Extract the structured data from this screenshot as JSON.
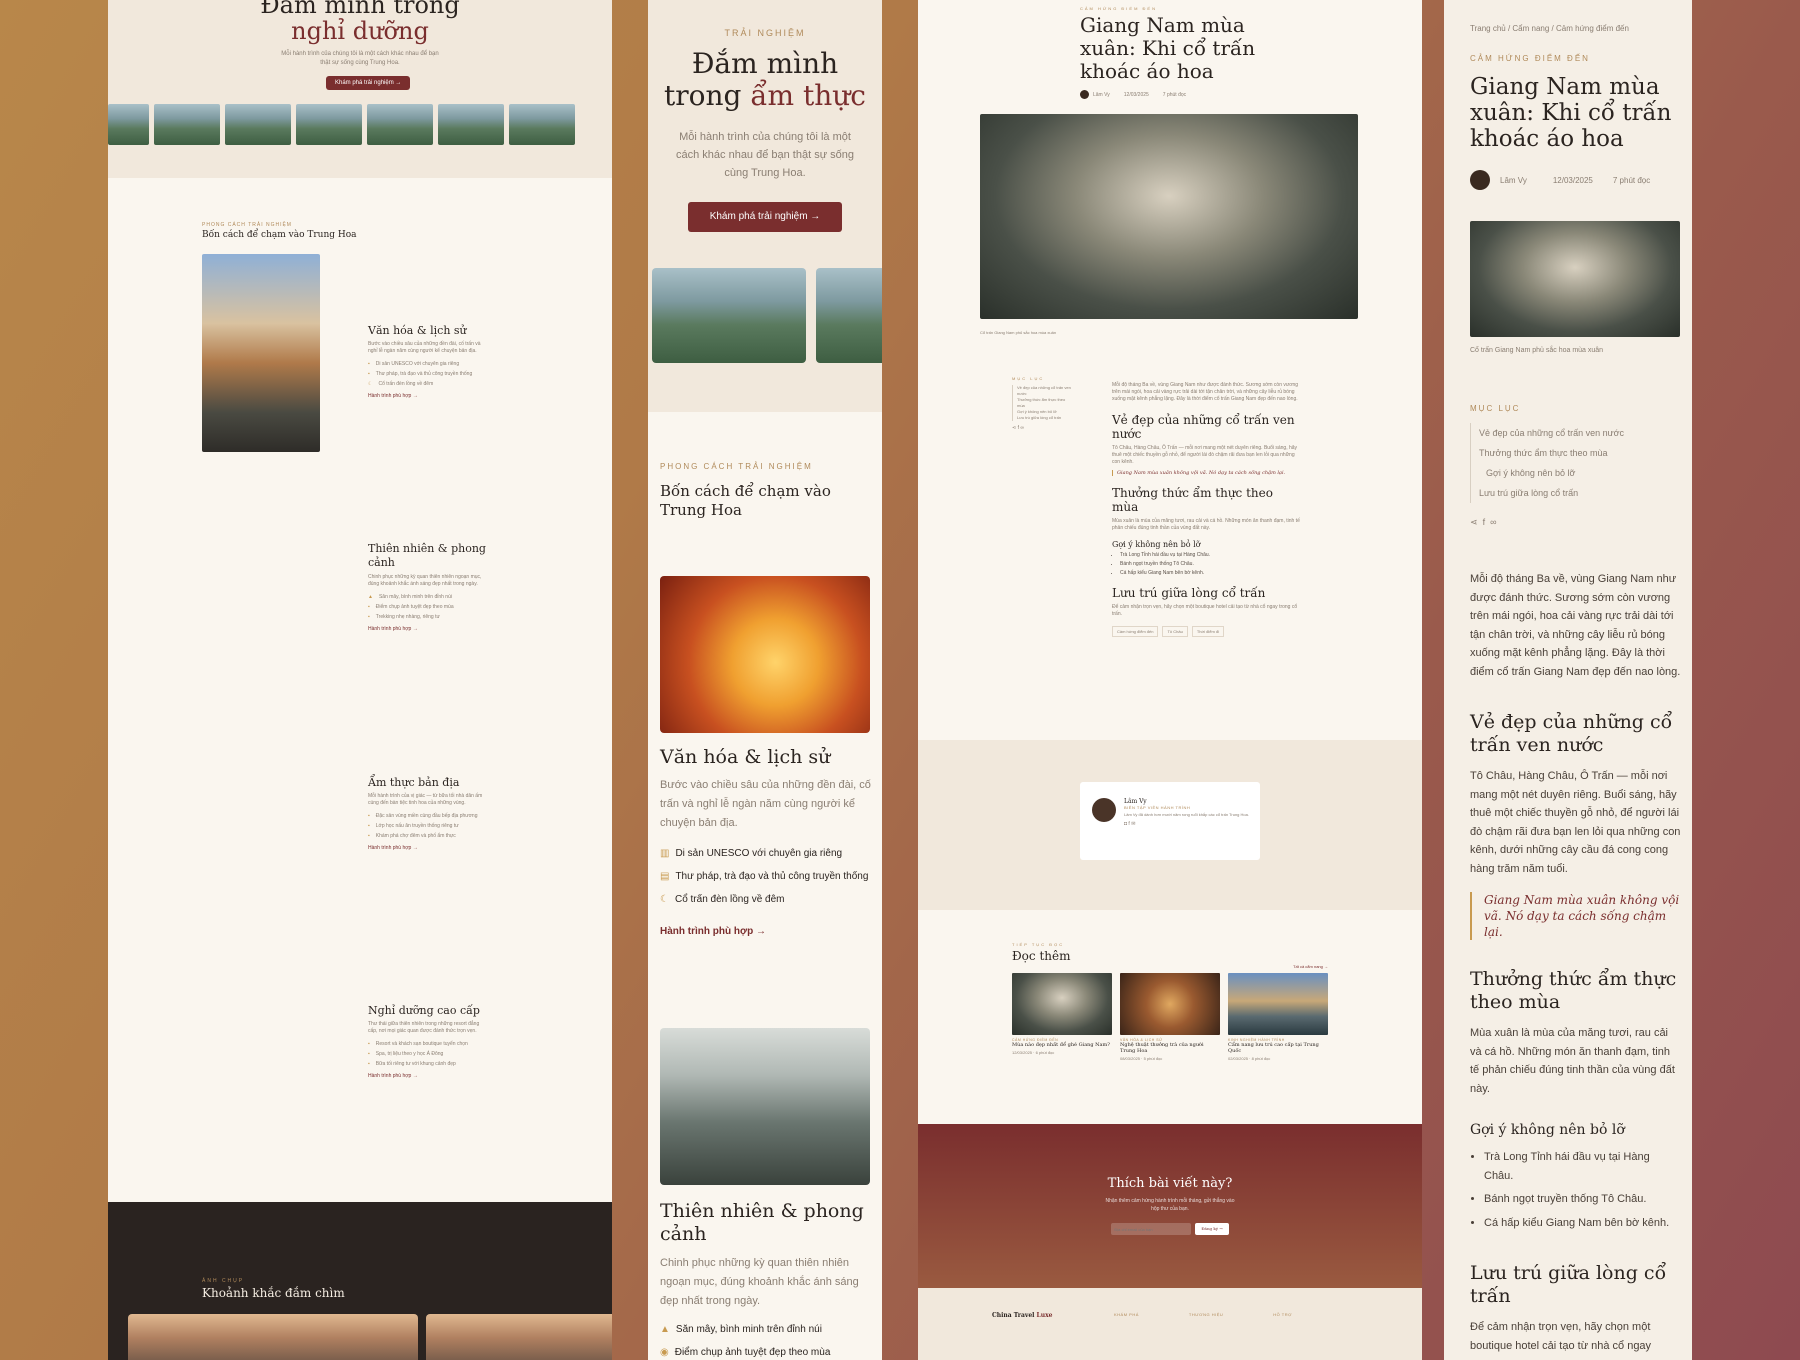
{
  "panel1": {
    "hero_title_1": "Đắm mình trong",
    "hero_title_2": "nghỉ dưỡng",
    "hero_sub": "Mỗi hành trình của chúng tôi là một cách khác nhau để bạn thật sự sống cùng Trung Hoa.",
    "hero_button": "Khám phá trải nghiệm",
    "section_eyebrow": "PHONG CÁCH TRẢI NGHIỆM",
    "section_title": "Bốn cách để chạm vào Trung Hoa",
    "cards": [
      {
        "title": "Văn hóa & lịch sử",
        "desc": "Bước vào chiều sâu của những đền đài, cố trấn và nghỉ lễ ngàn năm cùng người kể chuyện bản địa.",
        "items": [
          "Di sản UNESCO với chuyên gia riêng",
          "Thư pháp, trà đạo và thủ công truyền thống",
          "Cổ trấn đèn lồng về đêm"
        ],
        "link": "Hành trình phù hợp"
      },
      {
        "title": "Thiên nhiên & phong cảnh",
        "desc": "Chinh phục những kỳ quan thiên nhiên ngoạn mục, đúng khoảnh khắc ánh sáng đẹp nhất trong ngày.",
        "items": [
          "Săn mây, bình minh trên đỉnh núi",
          "Điểm chụp ảnh tuyệt đẹp theo mùa",
          "Trekking nhẹ nhàng, riêng tư"
        ],
        "link": "Hành trình phù hợp"
      },
      {
        "title": "Ẩm thực bản địa",
        "desc": "Mỗi hành trình của vị giác — từ bữa tối nhà dân ấm cúng đến bàn tiệc tinh hoa của những vùng.",
        "items": [
          "Đặc sản vùng miền cùng đầu bếp địa phương",
          "Lớp học nấu ăn truyền thống riêng tư",
          "Khám phá chợ đêm và phố ẩm thực"
        ],
        "link": "Hành trình phù hợp"
      },
      {
        "title": "Nghỉ dưỡng cao cấp",
        "desc": "Thư thái giữa thiên nhiên trong những resort đẳng cấp, nơi mọi giác quan được đánh thức trọn vẹn.",
        "items": [
          "Resort và khách sạn boutique tuyển chọn",
          "Spa, trị liệu theo y học Á Đông",
          "Bữa tối riêng tư với khung cảnh đẹp"
        ],
        "link": "Hành trình phù hợp"
      }
    ],
    "dark_eyebrow": "ẢNH CHỤP",
    "dark_title": "Khoảnh khắc đắm chìm"
  },
  "panel2": {
    "eyebrow": "TRẢI NGHIỆM",
    "title_1": "Đắm mình",
    "title_2": "trong",
    "title_3": "ẩm thực",
    "sub": "Mỗi hành trình của chúng tôi là một cách khác nhau để bạn thật sự sống cùng Trung Hoa.",
    "button": "Khám phá trải nghiệm",
    "section_eyebrow": "PHONG CÁCH TRẢI NGHIỆM",
    "section_title": "Bốn cách để chạm vào Trung Hoa",
    "card1": {
      "title": "Văn hóa & lịch sử",
      "desc": "Bước vào chiều sâu của những đền đài, cố trấn và nghỉ lễ ngàn năm cùng người kể chuyện bản địa.",
      "items": [
        "Di sản UNESCO với chuyên gia riêng",
        "Thư pháp, trà đạo và thủ công truyền thống",
        "Cổ trấn đèn lồng về đêm"
      ],
      "link": "Hành trình phù hợp"
    },
    "card2": {
      "title": "Thiên nhiên & phong cảnh",
      "desc": "Chinh phục những kỳ quan thiên nhiên ngoạn mục, đúng khoảnh khắc ánh sáng đẹp nhất trong ngày.",
      "items": [
        "Săn mây, bình minh trên đỉnh núi",
        "Điểm chụp ảnh tuyệt đẹp theo mùa"
      ]
    }
  },
  "panel3": {
    "eyebrow": "CẢM HỨNG ĐIỂM ĐẾN",
    "title": "Giang Nam mùa xuân: Khi cổ trấn khoác áo hoa",
    "author": "Lâm Vy",
    "date": "12/03/2025",
    "read": "7 phút đọc",
    "caption": "Cổ trấn Giang Nam phủ sắc hoa mùa xuân",
    "toc_label": "MỤC LỤC",
    "toc": [
      "Vẻ đẹp của những cổ trấn ven nước",
      "Thưởng thức ẩm thực theo mùa",
      "Gợi ý không nên bỏ lỡ",
      "Lưu trú giữa lòng cổ trấn"
    ],
    "intro": "Mỗi độ tháng Ba về, vùng Giang Nam như được đánh thức. Sương sớm còn vương trên mái ngói, hoa cải vàng rực trải dài tới tận chân trời, và những cây liễu rủ bóng xuống mặt kênh phẳng lặng. Đây là thời điểm cổ trấn Giang Nam đẹp đến nao lòng.",
    "h1": "Vẻ đẹp của những cổ trấn ven nước",
    "p1": "Tô Châu, Hàng Châu, Ô Trấn — mỗi nơi mang một nét duyên riêng. Buổi sáng, hãy thuê một chiếc thuyền gỗ nhỏ, để người lái đò chậm rãi đưa bạn len lỏi qua những con kênh.",
    "quote": "Giang Nam mùa xuân không vội vã. Nó dạy ta cách sống chậm lại.",
    "h2": "Thưởng thức ẩm thực theo mùa",
    "p2": "Mùa xuân là mùa của măng tươi, rau cải và cá hồ. Những món ăn thanh đạm, tinh tế phản chiếu đúng tinh thần của vùng đất này.",
    "h3": "Gợi ý không nên bỏ lỡ",
    "bullets": [
      "Trà Long Tỉnh hái đầu vụ tại Hàng Châu.",
      "Bánh ngọt truyền thống Tô Châu.",
      "Cá hấp kiểu Giang Nam bên bờ kênh."
    ],
    "h4": "Lưu trú giữa lòng cổ trấn",
    "p4": "Để cảm nhận trọn vẹn, hãy chọn một boutique hotel cải tạo từ nhà cổ ngay trong cổ trấn.",
    "tags": [
      "Cảm hứng điểm đến",
      "Tô Châu",
      "Thời điểm đi"
    ],
    "author_role": "BIÊN TẬP VIÊN HÀNH TRÌNH",
    "author_bio": "Lâm Vy đã dành hơn mười năm rong ruổi khắp các cổ trấn Trung Hoa.",
    "more_eyebrow": "TIẾP TỤC ĐỌC",
    "more_title": "Đọc thêm",
    "more_link": "Tất cả cẩm nang",
    "more": [
      {
        "cat": "CẢM HỨNG ĐIỂM ĐẾN",
        "title": "Mùa nào đẹp nhất để ghé Giang Nam?",
        "date": "12/03/2025",
        "read": "6 phút đọc"
      },
      {
        "cat": "VĂN HÓA & LỊCH SỬ",
        "title": "Nghệ thuật thưởng trà của người Trung Hoa",
        "date": "08/03/2025",
        "read": "5 phút đọc"
      },
      {
        "cat": "KINH NGHIỆM HÀNH TRÌNH",
        "title": "Cẩm nang lưu trú cao cấp tại Trung Quốc",
        "date": "02/03/2025",
        "read": "8 phút đọc"
      }
    ],
    "cta_title": "Thích bài viết này?",
    "cta_sub": "Nhận thêm cảm hứng hành trình mỗi tháng, gửi thẳng vào hộp thư của bạn.",
    "cta_placeholder": "Địa chỉ email của bạn",
    "cta_button": "Đăng ký",
    "footer_brand_1": "China Travel",
    "footer_brand_2": "Luxe",
    "footer_cols": [
      "KHÁM PHÁ",
      "THƯƠNG HIỆU",
      "HỖ TRỢ"
    ]
  },
  "panel4": {
    "breadcrumb": [
      "Trang chủ",
      "Cẩm nang",
      "Cảm hứng điểm đến"
    ],
    "eyebrow": "CẢM HỨNG ĐIỂM ĐẾN",
    "title": "Giang Nam mùa xuân: Khi cổ trấn khoác áo hoa",
    "author": "Lâm Vy",
    "date": "12/03/2025",
    "read": "7 phút đọc",
    "caption": "Cổ trấn Giang Nam phủ sắc hoa mùa xuân",
    "toc_label": "MỤC LỤC",
    "toc": [
      "Vẻ đẹp của những cổ trấn ven nước",
      "Thưởng thức ẩm thực theo mùa",
      "Gợi ý không nên bỏ lỡ",
      "Lưu trú giữa lòng cổ trấn"
    ],
    "intro": "Mỗi độ tháng Ba về, vùng Giang Nam như được đánh thức. Sương sớm còn vương trên mái ngói, hoa cải vàng rực trải dài tới tận chân trời, và những cây liễu rủ bóng xuống mặt kênh phẳng lặng. Đây là thời điểm cổ trấn Giang Nam đẹp đến nao lòng.",
    "h1": "Vẻ đẹp của những cổ trấn ven nước",
    "p1": "Tô Châu, Hàng Châu, Ô Trấn — mỗi nơi mang một nét duyên riêng. Buổi sáng, hãy thuê một chiếc thuyền gỗ nhỏ, để người lái đò chậm rãi đưa bạn len lỏi qua những con kênh, dưới những cây cầu đá cong cong hàng trăm năm tuổi.",
    "quote": "Giang Nam mùa xuân không vội vã. Nó dạy ta cách sống chậm lại.",
    "h2": "Thưởng thức ẩm thực theo mùa",
    "p2": "Mùa xuân là mùa của măng tươi, rau cải và cá hồ. Những món ăn thanh đạm, tinh tế phản chiếu đúng tinh thần của vùng đất này.",
    "h3": "Gợi ý không nên bỏ lỡ",
    "bullets": [
      "Trà Long Tỉnh hái đầu vụ tại Hàng Châu.",
      "Bánh ngọt truyền thống Tô Châu.",
      "Cá hấp kiểu Giang Nam bên bờ kênh."
    ],
    "h4": "Lưu trú giữa lòng cổ trấn",
    "p4": "Để cảm nhận trọn vẹn, hãy chọn một boutique hotel cải tạo từ nhà cổ ngay"
  }
}
